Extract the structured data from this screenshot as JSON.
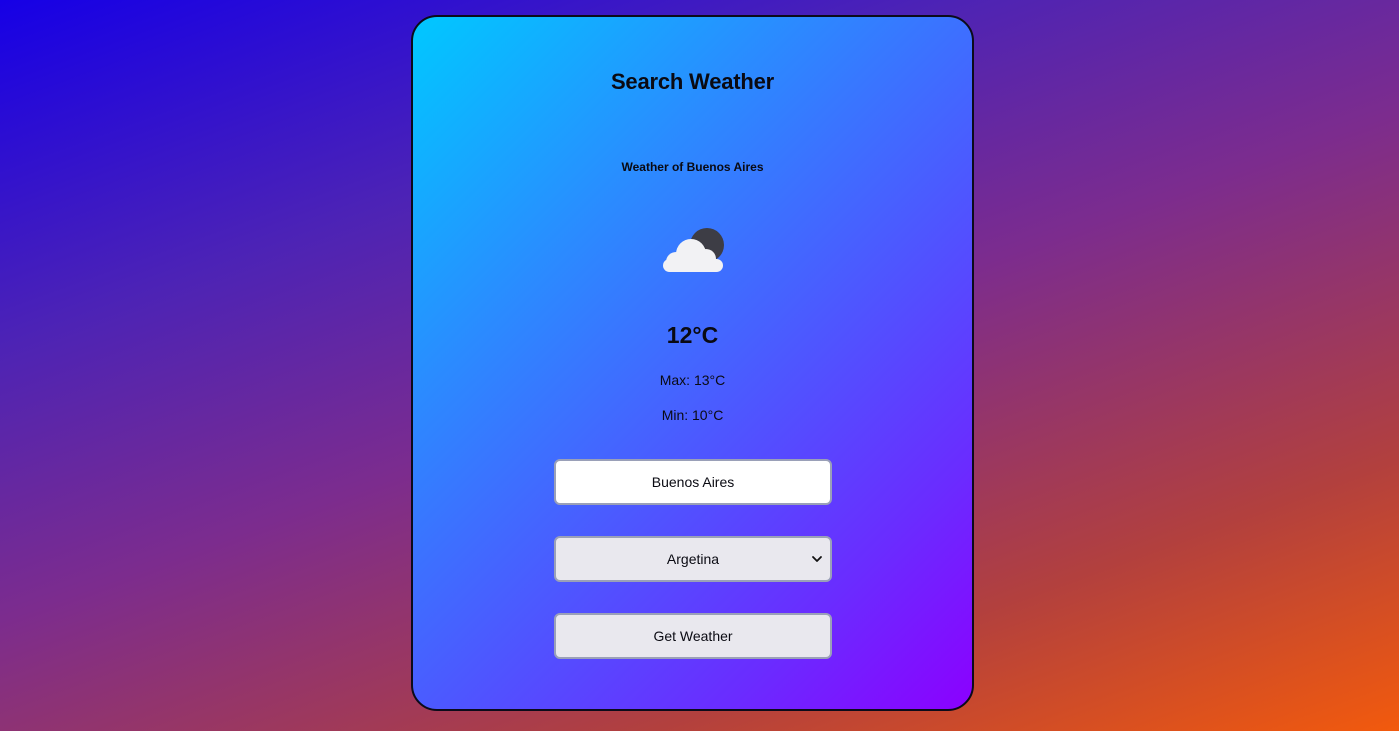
{
  "app": {
    "title": "Search Weather"
  },
  "weather": {
    "location_text": "Weather of Buenos Aires",
    "icon": "cloud-moon-icon",
    "temperature": "12°C",
    "max": "Max: 13°C",
    "min": "Min: 10°C"
  },
  "form": {
    "city_value": "Buenos Aires",
    "country_selected": "Argetina",
    "submit_label": "Get Weather"
  },
  "colors": {
    "background_start": "#1600e6",
    "background_end": "#f25a0d",
    "card_start": "#00c8ff",
    "card_end": "#8b00ff",
    "text": "#0a0a12",
    "control_bg": "#e9e8ee",
    "input_bg": "#ffffff"
  }
}
